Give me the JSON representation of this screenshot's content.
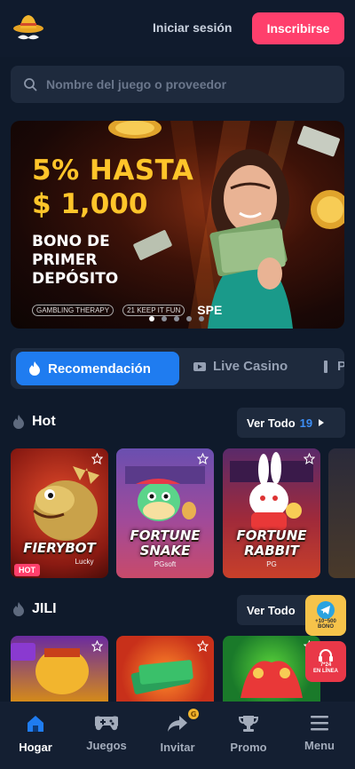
{
  "header": {
    "login_label": "Iniciar sesión",
    "signup_label": "Inscribirse"
  },
  "search": {
    "placeholder": "Nombre del juego o proveedor"
  },
  "banner": {
    "headline_1": "5% HASTA",
    "headline_2": "$ 1,000",
    "subtitle": "BONO DE PRIMER DEPÓSITO",
    "partners": [
      "GAMBLING THERAPY",
      "21 KEEP IT FUN",
      "SPE"
    ],
    "slide_count": 5,
    "active_slide": 1
  },
  "tabs": {
    "active": "Recomendación",
    "second": "Live Casino",
    "third_partial": "P"
  },
  "sections": {
    "hot": {
      "title": "Hot",
      "see_all": "Ver Todo",
      "count": "19",
      "games": [
        {
          "name": "FIERYBOT",
          "provider": "Lucky",
          "badge": "HOT"
        },
        {
          "name": "FORTUNE SNAKE",
          "provider": "PGsoft"
        },
        {
          "name": "FORTUNE RABBIT",
          "provider": "PG"
        }
      ]
    },
    "jili": {
      "title": "JILI",
      "see_all": "Ver Todo"
    }
  },
  "floaters": {
    "telegram_line1": "+10~500",
    "telegram_line2": "BONO",
    "chat_line1": "7*24",
    "chat_line2": "EN LÍNEA"
  },
  "bottom_nav": [
    {
      "label": "Hogar",
      "icon": "home-icon",
      "active": true
    },
    {
      "label": "Juegos",
      "icon": "gamepad-icon"
    },
    {
      "label": "Invitar",
      "icon": "share-icon"
    },
    {
      "label": "Promo",
      "icon": "trophy-icon"
    },
    {
      "label": "Menu",
      "icon": "menu-icon"
    }
  ],
  "colors": {
    "background": "#0f1a2b",
    "accent_pink": "#ff3f6c",
    "accent_blue": "#1f7cf0",
    "gold": "#ffc52a"
  }
}
